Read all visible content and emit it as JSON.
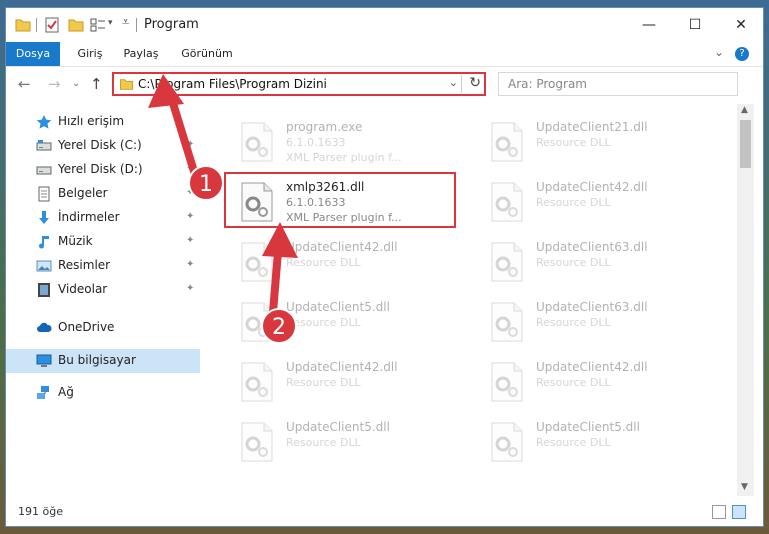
{
  "window": {
    "title": "Program",
    "controls": {
      "minimize": "—",
      "maximize": "☐",
      "close": "✕"
    }
  },
  "ribbon": {
    "tabs": [
      "Dosya",
      "Giriş",
      "Paylaş",
      "Görünüm"
    ],
    "help": "?",
    "collapse": "⌄"
  },
  "nav": {
    "back": "←",
    "forward": "→",
    "dropdown": "⌄",
    "up": "↑",
    "address": "C:\\Program Files\\Program Dizini",
    "address_dropdown": "⌄",
    "refresh": "↻",
    "search_placeholder": "Ara: Program"
  },
  "sidebar": {
    "items": [
      {
        "label": "Hızlı erişim",
        "icon": "star-icon",
        "pinned": false
      },
      {
        "label": "Yerel Disk (C:)",
        "icon": "drive-icon",
        "pinned": true
      },
      {
        "label": "Yerel Disk (D:)",
        "icon": "drive-icon",
        "pinned": true
      },
      {
        "label": "Belgeler",
        "icon": "document-icon",
        "pinned": true
      },
      {
        "label": "İndirmeler",
        "icon": "download-icon",
        "pinned": true
      },
      {
        "label": "Müzik",
        "icon": "music-icon",
        "pinned": true
      },
      {
        "label": "Resimler",
        "icon": "picture-icon",
        "pinned": true
      },
      {
        "label": "Videolar",
        "icon": "video-icon",
        "pinned": true
      },
      {
        "label": "OneDrive",
        "icon": "cloud-icon",
        "pinned": false
      },
      {
        "label": "Bu bilgisayar",
        "icon": "computer-icon",
        "pinned": false,
        "selected": true
      },
      {
        "label": "Ağ",
        "icon": "network-icon",
        "pinned": false
      }
    ],
    "pin_glyph": "📌"
  },
  "files": [
    {
      "name": "program.exe",
      "version": "6.1.0.1633",
      "desc": "XML Parser plugin f..."
    },
    {
      "name": "UpdateClient21.dll",
      "version": "",
      "desc": "Resource DLL"
    },
    {
      "name": "xmlp3261.dll",
      "version": "6.1.0.1633",
      "desc": "XML Parser plugin f...",
      "highlighted": true
    },
    {
      "name": "UpdateClient42.dll",
      "version": "",
      "desc": "Resource DLL"
    },
    {
      "name": "UpdateClient42.dll",
      "version": "",
      "desc": "Resource DLL"
    },
    {
      "name": "UpdateClient63.dll",
      "version": "",
      "desc": "Resource DLL"
    },
    {
      "name": "UpdateClient5.dll",
      "version": "",
      "desc": "Resource DLL"
    },
    {
      "name": "UpdateClient63.dll",
      "version": "",
      "desc": "Resource DLL"
    },
    {
      "name": "UpdateClient42.dll",
      "version": "",
      "desc": "Resource DLL"
    },
    {
      "name": "UpdateClient42.dll",
      "version": "",
      "desc": "Resource DLL"
    },
    {
      "name": "UpdateClient5.dll",
      "version": "",
      "desc": "Resource DLL"
    },
    {
      "name": "UpdateClient5.dll",
      "version": "",
      "desc": "Resource DLL"
    }
  ],
  "status": {
    "count": "191 öğe"
  },
  "annotations": {
    "step1": "1",
    "step2": "2",
    "color": "#d9373e"
  }
}
